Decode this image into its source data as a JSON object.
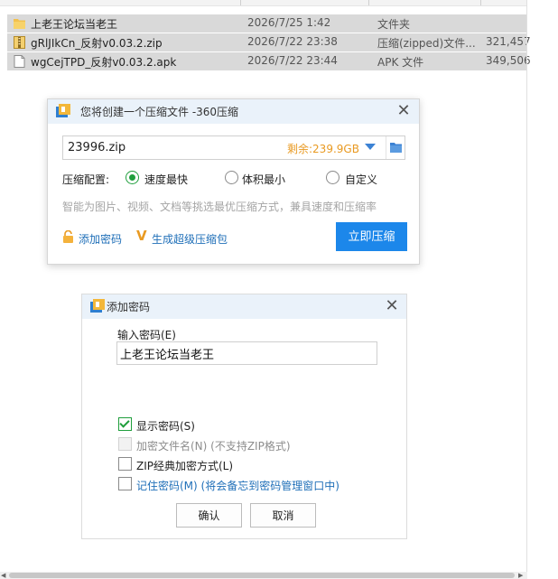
{
  "files": [
    {
      "name": "上老王论坛当老王",
      "date": "2026/7/25 1:42",
      "type": "文件夹",
      "size": "",
      "icon": "folder-icon",
      "selected": true
    },
    {
      "name": "gRlJIkCn_反射v0.03.2.zip",
      "date": "2026/7/22 23:38",
      "type": "压缩(zipped)文件...",
      "size": "321,457",
      "icon": "zip-file-icon",
      "selected": true
    },
    {
      "name": "wgCejTPD_反射v0.03.2.apk",
      "date": "2026/7/22 23:44",
      "type": "APK 文件",
      "size": "349,506",
      "icon": "file-icon",
      "selected": true
    }
  ],
  "compress_dialog": {
    "title": "您将创建一个压缩文件 -360压缩",
    "filename": "23996.zip",
    "remaining": "剩余:239.9GB",
    "config_label": "压缩配置:",
    "options": [
      {
        "label": "速度最快",
        "selected": true
      },
      {
        "label": "体积最小",
        "selected": false
      },
      {
        "label": "自定义",
        "selected": false
      }
    ],
    "hint": "智能为图片、视频、文档等挑选最优压缩方式，兼具速度和压缩率",
    "add_password": "添加密码",
    "super_pack": "生成超级压缩包",
    "compress_button": "立即压缩",
    "accent_color": "#1c87ea",
    "remaining_color": "#e99a22"
  },
  "password_dialog": {
    "title": "添加密码",
    "input_label": "输入密码(E)",
    "password_value": "上老王论坛当老王",
    "checkboxes": [
      {
        "label": "显示密码(S)",
        "checked": true,
        "disabled": false,
        "style": "normal"
      },
      {
        "label": "加密文件名(N) (不支持ZIP格式)",
        "checked": false,
        "disabled": true,
        "style": "dim"
      },
      {
        "label": "ZIP经典加密方式(L)",
        "checked": false,
        "disabled": false,
        "style": "normal"
      },
      {
        "label": "记住密码(M) (将会备忘到密码管理窗口中)",
        "checked": false,
        "disabled": false,
        "style": "blue"
      }
    ],
    "ok_button": "确认",
    "cancel_button": "取消"
  }
}
